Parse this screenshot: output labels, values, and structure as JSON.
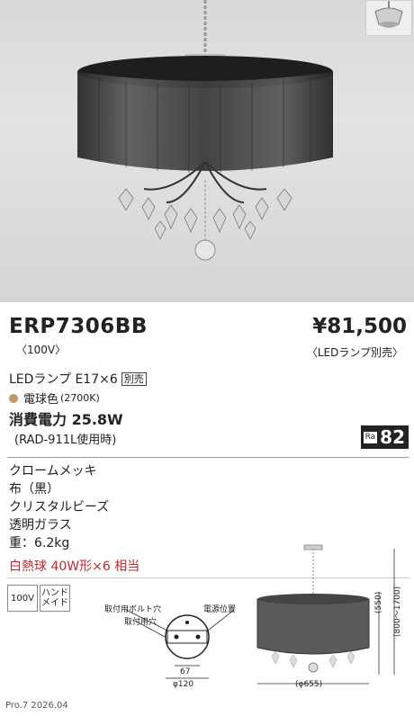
{
  "product": {
    "model": "ERP7306BB",
    "voltage": "〈100V〉",
    "price": "¥81,500",
    "price_note": "〈LEDランプ別売〉"
  },
  "lamp": {
    "text": "LEDランプ E17×6",
    "separate_tag": "別売"
  },
  "color": {
    "label": "電球色",
    "temp": "(2700K)",
    "swatch": "#c19a6b"
  },
  "power": {
    "label": "消費電力 25.8W",
    "condition": "(RAD-911L使用時)"
  },
  "ra": {
    "label": "Ra",
    "value": "82"
  },
  "specs": [
    "クロームメッキ",
    "布（黒）",
    "クリスタルビーズ",
    "透明ガラス",
    "重：6.2kg"
  ],
  "equivalent": "白熱球 40W形×6 相当",
  "tags": {
    "voltage": "100V",
    "handmade": "ハンド\nメイド"
  },
  "drawing": {
    "bolt_hole": "取付用ボルト穴",
    "mount_hole": "取付用穴",
    "power_position": "電源位置",
    "dim_67": "67",
    "dim_120": "φ120",
    "dim_655": "(φ655)",
    "dim_550": "(550)",
    "dim_range": "(800〜1700)"
  },
  "footer": "Pro.7 2026.04",
  "icons": [
    "pendant-photo",
    "ceiling-canopy-thumbnail",
    "mounting-plate-diagram",
    "silhouette-diagram"
  ]
}
